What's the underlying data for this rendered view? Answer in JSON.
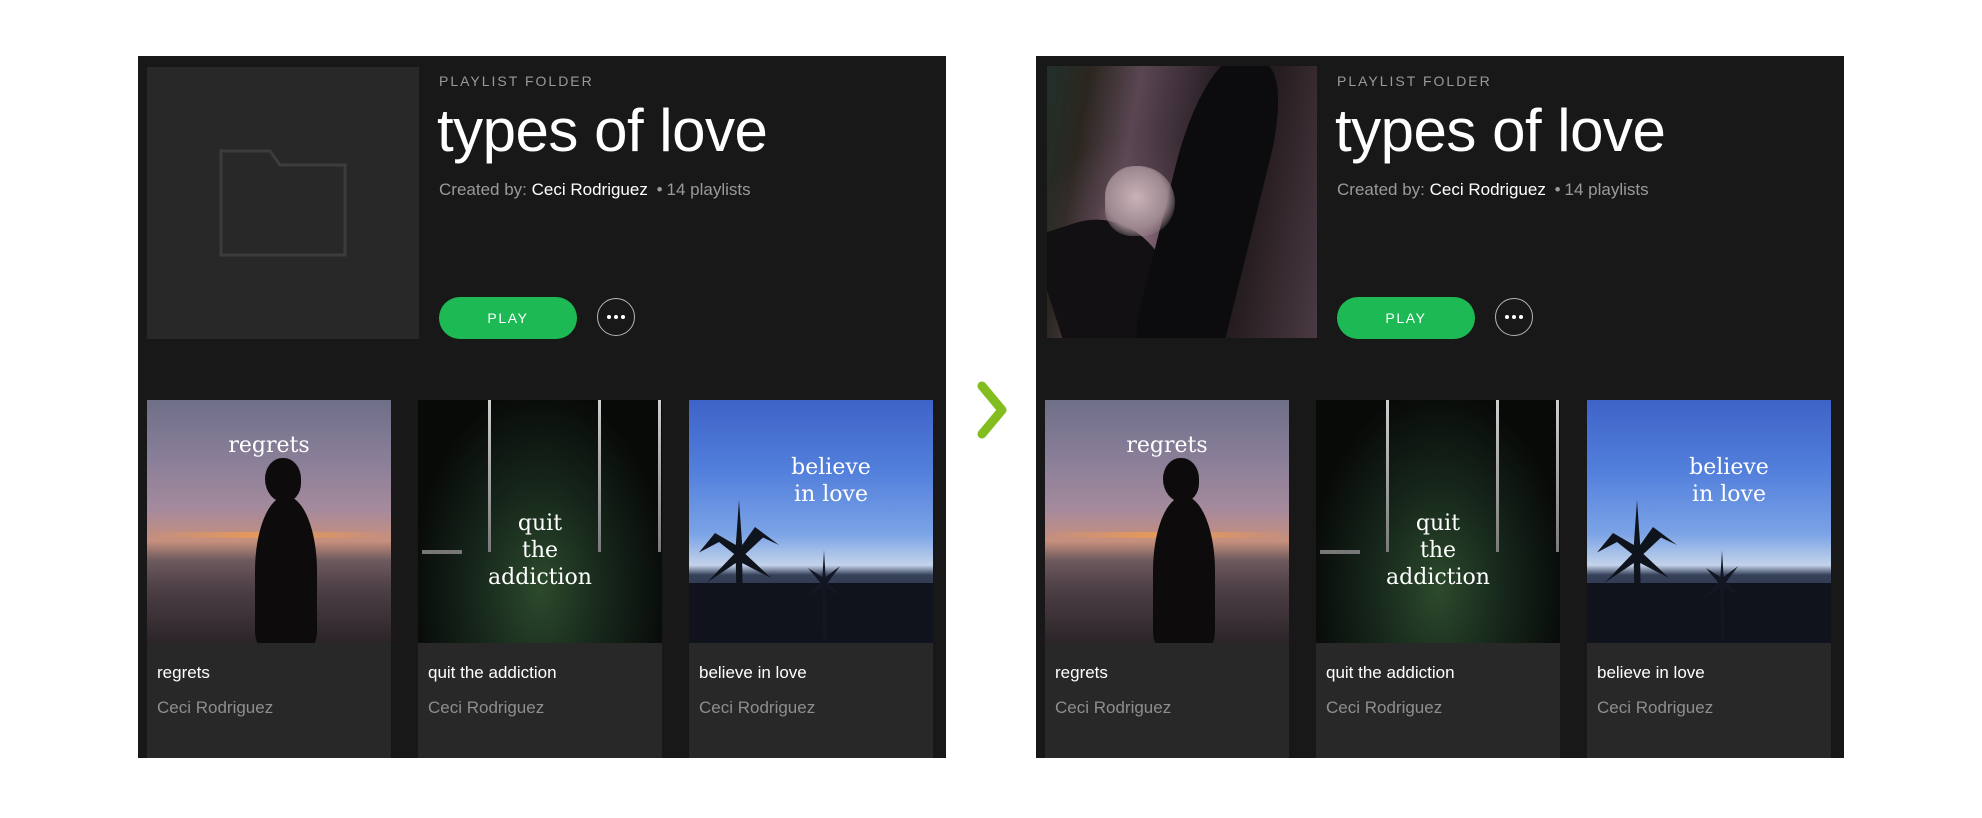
{
  "colors": {
    "panel_bg": "#181818",
    "card_bg": "#282828",
    "accent": "#1db954",
    "arrow": "#84bd1f"
  },
  "panels": [
    {
      "cover": "folder-icon",
      "type_label": "PLAYLIST FOLDER",
      "title": "types of love",
      "created_prefix": "Created by:",
      "owner": "Ceci Rodriguez",
      "separator": "•",
      "count": "14 playlists",
      "play_label": "PLAY",
      "more_icon": "more-options-icon"
    },
    {
      "cover": "photo-holding-hands",
      "type_label": "PLAYLIST FOLDER",
      "title": "types of love",
      "created_prefix": "Created by:",
      "owner": "Ceci Rodriguez",
      "separator": "•",
      "count": "14 playlists",
      "play_label": "PLAY",
      "more_icon": "more-options-icon"
    }
  ],
  "cards": [
    {
      "art_text": "regrets",
      "name": "regrets",
      "owner": "Ceci Rodriguez"
    },
    {
      "art_text": "quit\nthe\naddiction",
      "name": "quit the addiction",
      "owner": "Ceci Rodriguez"
    },
    {
      "art_text": "believe\nin love",
      "name": "believe in love",
      "owner": "Ceci Rodriguez"
    }
  ],
  "transition_icon": "chevron-right-icon"
}
